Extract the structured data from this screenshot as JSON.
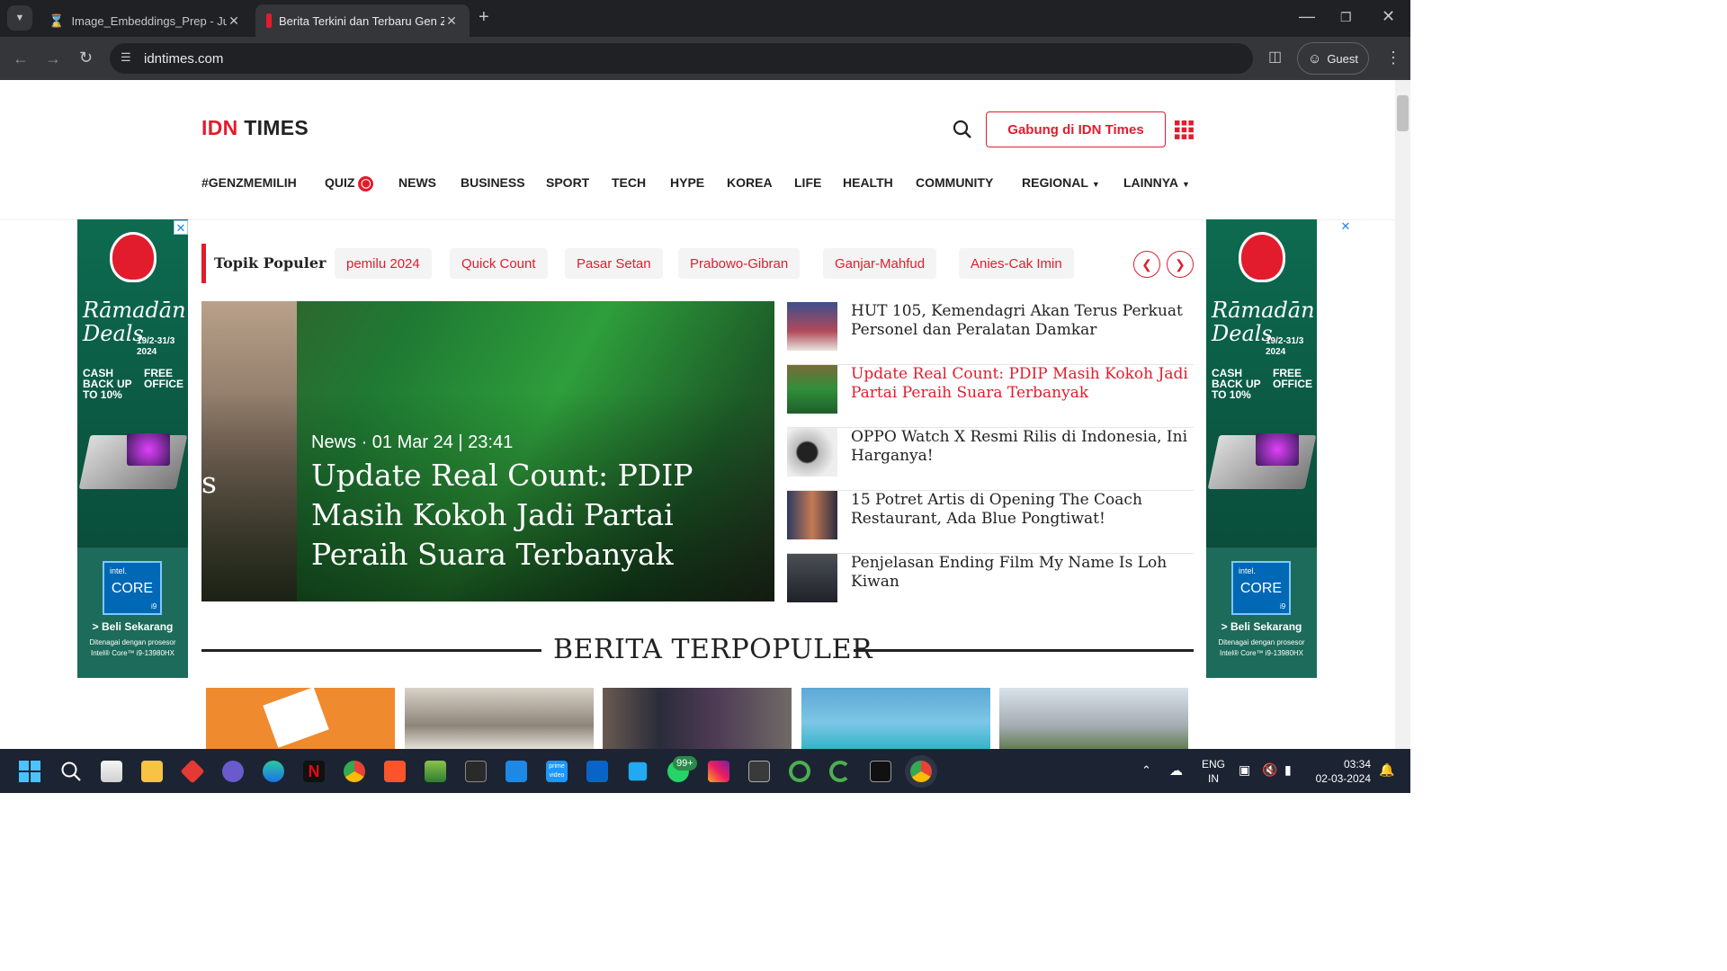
{
  "browser": {
    "tabs": [
      {
        "title": "Image_Embeddings_Prep - Jupy",
        "active": false
      },
      {
        "title": "Berita Terkini dan Terbaru Gen Z",
        "active": true
      }
    ],
    "url": "idntimes.com",
    "profile": "Guest"
  },
  "site": {
    "logo_primary": "IDN",
    "logo_secondary": "TIMES",
    "join_button": "Gabung di IDN Times",
    "nav": [
      {
        "label": "#GENZMEMILIH",
        "dropdown": false
      },
      {
        "label": "QUIZ",
        "dropdown": false
      },
      {
        "label": "NEWS",
        "dropdown": false
      },
      {
        "label": "BUSINESS",
        "dropdown": false
      },
      {
        "label": "SPORT",
        "dropdown": false
      },
      {
        "label": "TECH",
        "dropdown": false
      },
      {
        "label": "HYPE",
        "dropdown": false
      },
      {
        "label": "KOREA",
        "dropdown": false
      },
      {
        "label": "LIFE",
        "dropdown": false
      },
      {
        "label": "HEALTH",
        "dropdown": false
      },
      {
        "label": "COMMUNITY",
        "dropdown": false
      },
      {
        "label": "REGIONAL",
        "dropdown": true
      },
      {
        "label": "LAINNYA",
        "dropdown": true
      }
    ],
    "accent_color": "#e21c2d"
  },
  "topik": {
    "title": "Topik Populer",
    "chips": [
      "pemilu 2024",
      "Quick Count",
      "Pasar Setan",
      "Prabowo-Gibran",
      "Ganjar-Mahfud",
      "Anies-Cak Imin"
    ]
  },
  "hero": {
    "category_time": "News · 01 Mar 24 | 23:41",
    "title": "Update Real Count: PDIP Masih Kokoh Jadi Partai Peraih Suara Terbanyak"
  },
  "side_list": [
    {
      "title": "HUT 105, Kemendagri Akan Terus Perkuat Personel dan Peralatan Damkar",
      "active": false
    },
    {
      "title": "Update Real Count: PDIP Masih Kokoh Jadi Partai Peraih Suara Terbanyak",
      "active": true
    },
    {
      "title": "OPPO Watch X Resmi Rilis di Indonesia, Ini Harganya!",
      "active": false
    },
    {
      "title": "15 Potret Artis di Opening The Coach Restaurant, Ada Blue Pongtiwat!",
      "active": false
    },
    {
      "title": "Penjelasan Ending Film My Name Is Loh Kiwan",
      "active": false
    }
  ],
  "section": {
    "title": "BERITA TERPOPULER"
  },
  "ad": {
    "headline": "Rāmadān Deals",
    "dates": "19/2-31/3 2024",
    "cashback": "CASH BACK UP TO 10%",
    "free": "FREE OFFICE",
    "chip_brand": "intel.",
    "chip_name": "CORE",
    "chip_tier": "i9",
    "cta": "> Beli Sekarang",
    "footnote": "Ditenagai dengan prosesor Intel® Core™ i9-13980HX"
  },
  "taskbar": {
    "lang": "ENG",
    "region": "IN",
    "time": "03:34",
    "date": "02-03-2024",
    "whatsapp_badge": "99+"
  }
}
